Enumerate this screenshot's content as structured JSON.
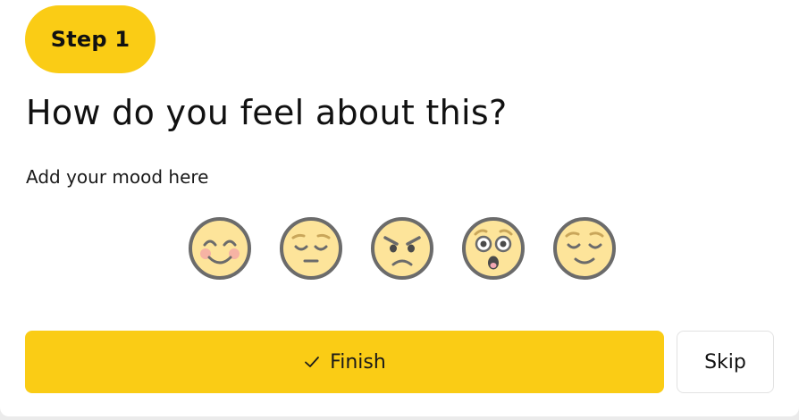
{
  "step": {
    "label": "Step 1"
  },
  "question": {
    "title": "How do you feel about this?",
    "subtitle": "Add your mood here"
  },
  "moods": [
    {
      "icon": "happy-blushing-face-icon"
    },
    {
      "icon": "sad-pensive-face-icon"
    },
    {
      "icon": "angry-face-icon"
    },
    {
      "icon": "shocked-face-icon"
    },
    {
      "icon": "relieved-smiling-face-icon"
    }
  ],
  "actions": {
    "finish_label": "Finish",
    "finish_icon": "check-icon",
    "skip_label": "Skip"
  },
  "colors": {
    "accent": "#facc15",
    "face_fill": "#fde49a",
    "face_stroke": "#6b6b6b",
    "text": "#111111"
  }
}
